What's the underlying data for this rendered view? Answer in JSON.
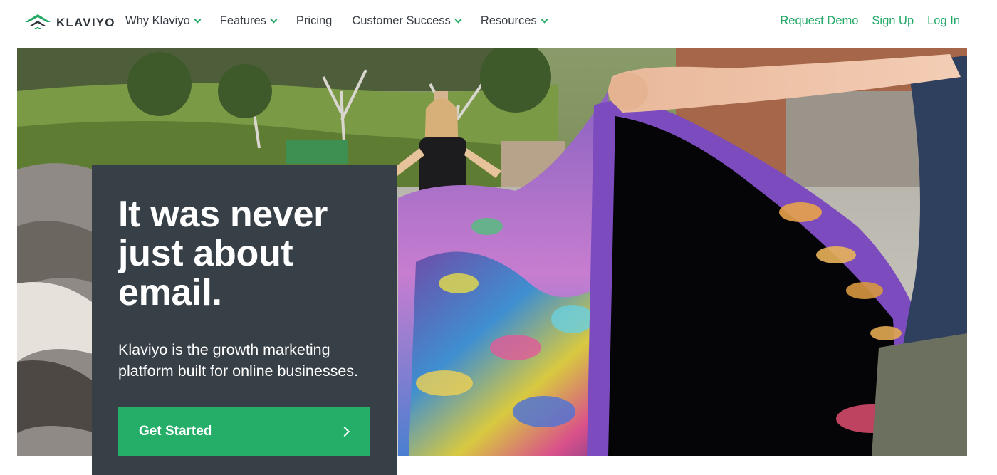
{
  "nav": {
    "brand": "KLAVIYO",
    "logo_icon": "wifi-signal-logo-icon",
    "menu": [
      {
        "label": "Why Klaviyo",
        "dropdown": true
      },
      {
        "label": "Features",
        "dropdown": true
      },
      {
        "label": "Pricing",
        "dropdown": false
      },
      {
        "label": "Customer Success",
        "dropdown": true
      },
      {
        "label": "Resources",
        "dropdown": true
      }
    ],
    "right_links": [
      "Request Demo",
      "Sign Up",
      "Log In"
    ]
  },
  "hero": {
    "headline": [
      "It was never",
      "just about",
      "email."
    ],
    "subheadline": "Klaviyo is the growth marketing platform built for online businesses.",
    "cta_label": "Get Started",
    "cta_icon": "chevron-right-icon"
  },
  "colors": {
    "brand_green": "#24ae68",
    "card_dark": "#373f47",
    "link_green": "#23a866",
    "text_dark": "#373d44"
  }
}
